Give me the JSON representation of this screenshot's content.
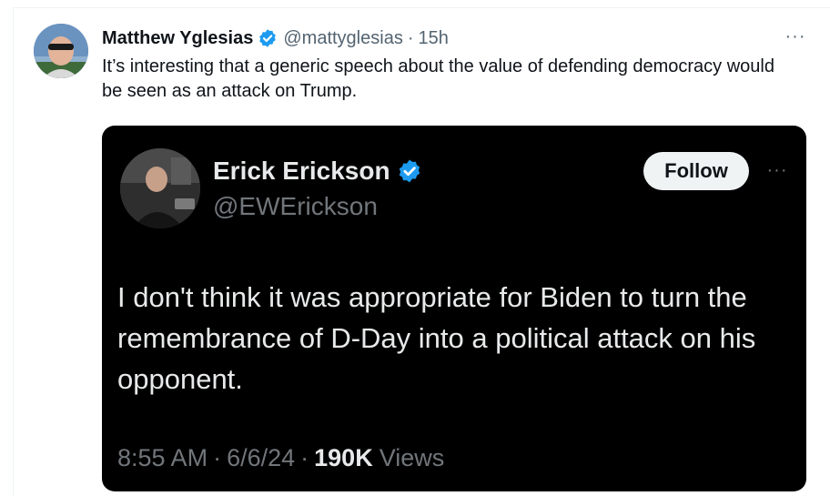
{
  "post": {
    "author_name": "Matthew Yglesias",
    "handle": "@mattyglesias",
    "separator": "·",
    "time": "15h",
    "more_label": "···",
    "text": "It’s interesting that a generic speech about the value of defending democracy would be seen as an attack on Trump."
  },
  "quoted_post": {
    "author_name": "Erick Erickson",
    "handle": "@EWErickson",
    "follow_label": "Follow",
    "more_label": "···",
    "text": "I don't think it was appropriate for Biden to turn the remembrance of D-Day into a political attack on his opponent.",
    "time": "8:55 AM",
    "separator": "·",
    "date": "6/6/24",
    "views_count": "190K",
    "views_label": "Views"
  },
  "icons": {
    "verified": "verified-badge-icon",
    "more": "more-options-icon"
  },
  "colors": {
    "verified_blue": "#1d9bf0",
    "text_primary": "#0f1419",
    "text_secondary": "#536471",
    "quote_background": "#000000",
    "quote_text": "#e7e9ea",
    "quote_secondary": "#71767b",
    "follow_button_bg": "#eff3f4"
  }
}
